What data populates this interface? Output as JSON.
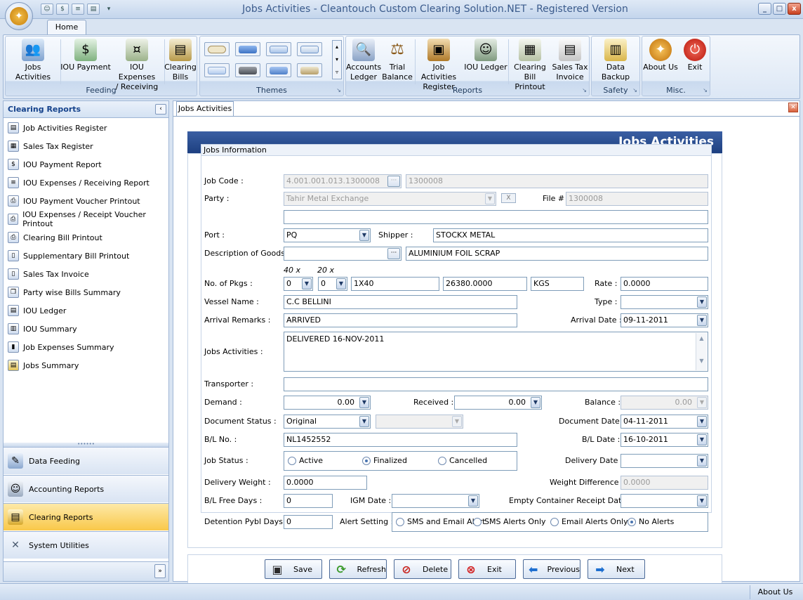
{
  "window": {
    "title": "Jobs Activities - Cleantouch Custom Clearing Solution.NET - Registered Version",
    "controls": [
      "_",
      "□",
      "x"
    ]
  },
  "ribbon": {
    "tab_home": "Home",
    "groups": {
      "feeding": {
        "label": "Feeding",
        "buttons": [
          "Jobs Activities",
          "IOU Payment",
          "IOU Expenses",
          "/ Receiving",
          "Clearing",
          "Bills"
        ]
      },
      "themes": {
        "label": "Themes"
      },
      "reports": {
        "label": "Reports",
        "buttons": [
          "Accounts",
          "Ledger",
          "Trial",
          "Balance",
          "Job Activities",
          "Register",
          "IOU Ledger",
          "Clearing Bill",
          "Printout",
          "Sales Tax",
          "Invoice"
        ]
      },
      "safety": {
        "label": "Safety",
        "buttons": [
          "Data Backup"
        ]
      },
      "misc": {
        "label": "Misc.",
        "buttons": [
          "About Us",
          "Exit"
        ]
      }
    }
  },
  "left_panel": {
    "title": "Clearing Reports",
    "items": [
      "Job Activities Register",
      "Sales Tax Register",
      "IOU Payment Report",
      "IOU Expenses / Receiving Report",
      "IOU Payment Voucher Printout",
      "IOU Expenses / Receipt Voucher Printout",
      "Clearing Bill Printout",
      "Supplementary Bill Printout",
      "Sales Tax Invoice",
      "Party wise Bills Summary",
      "IOU Ledger",
      "IOU Summary",
      "Job Expenses Summary",
      "Jobs Summary"
    ],
    "nav": [
      "Data Feeding",
      "Accounting Reports",
      "Clearing Reports",
      "System Utilities"
    ],
    "active_nav": "Clearing Reports"
  },
  "document": {
    "tab": "Jobs Activities",
    "banner": "Jobs Activities",
    "group_title": "Jobs Information"
  },
  "form": {
    "labels": {
      "job_code": "Job Code :",
      "party": "Party :",
      "file_no": "File #",
      "port": "Port :",
      "shipper": "Shipper :",
      "desc_goods": "Description of Goods :",
      "pkgs_40": "40 x",
      "pkgs_20": "20 x",
      "no_pkgs": "No. of Pkgs :",
      "rate": "Rate :",
      "vessel": "Vessel Name :",
      "type": "Type :",
      "arrival_remarks": "Arrival Remarks :",
      "arrival_date": "Arrival Date :",
      "jobs_activities": "Jobs Activities :",
      "transporter": "Transporter :",
      "demand": "Demand :",
      "received": "Received :",
      "balance": "Balance :",
      "doc_status": "Document Status :",
      "doc_date": "Document Date :",
      "bl_no": "B/L No. :",
      "bl_date": "B/L Date :",
      "job_status": "Job Status :",
      "delivery_date": "Delivery Date :",
      "delivery_weight": "Delivery Weight :",
      "weight_diff": "Weight Difference :",
      "bl_free_days": "B/L Free Days :",
      "igm_date": "IGM Date :",
      "empty_container": "Empty Container Receipt Date :",
      "detention": "Detention Pybl Days :",
      "alert_setting": "Alert Setting :"
    },
    "values": {
      "job_code": "4.001.001.013.1300008",
      "job_code_2": "1300008",
      "party": "Tahir Metal Exchange",
      "party_clear": "X",
      "file_no": "1300008",
      "port": "PQ",
      "shipper": "STOCKX METAL",
      "desc_goods": "ALUMINIUM FOIL SCRAP",
      "pkgs_40": "0",
      "pkgs_20": "0",
      "pkgs_desc": "1X40",
      "weight": "26380.0000",
      "unit": "KGS",
      "rate": "0.0000",
      "vessel": "C.C BELLINI",
      "arrival_remarks": "ARRIVED",
      "arrival_date": "09-11-2011",
      "jobs_activities": "DELIVERED 16-NOV-2011",
      "demand": "0.00",
      "received": "0.00",
      "balance": "0.00",
      "doc_status": "Original",
      "doc_date": "04-11-2011",
      "bl_no": "NL1452552",
      "bl_date": "16-10-2011",
      "delivery_weight": "0.0000",
      "weight_diff": "0.0000",
      "bl_free_days": "0",
      "detention": "0"
    },
    "job_status_options": [
      "Active",
      "Finalized",
      "Cancelled"
    ],
    "job_status_selected": "Finalized",
    "alert_options": [
      "SMS and Email Alert",
      "SMS Alerts Only",
      "Email Alerts Only",
      "No Alerts"
    ],
    "alert_selected": "No Alerts"
  },
  "actions": [
    "Save",
    "Refresh",
    "Delete",
    "Exit",
    "Previous",
    "Next"
  ],
  "status_bar": {
    "about": "About Us"
  },
  "colors": {
    "banner": "#1d3f80",
    "active_nav": "#f9c849",
    "title_text": "#3b5b8c"
  }
}
